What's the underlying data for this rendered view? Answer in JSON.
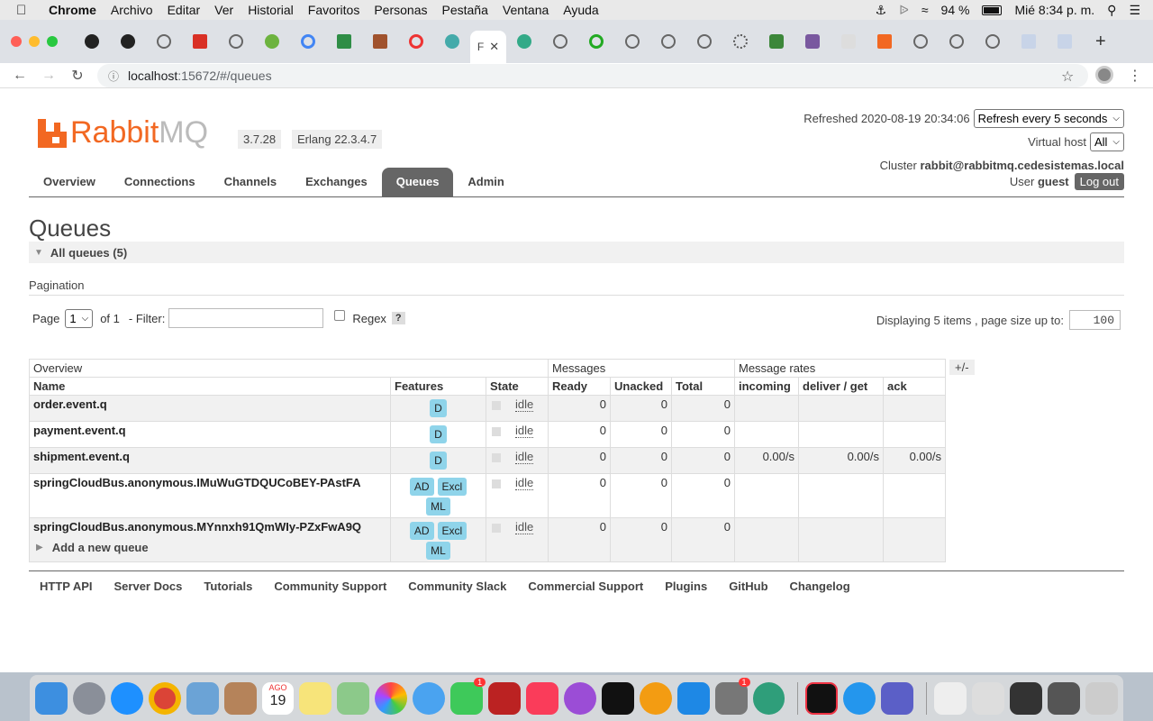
{
  "menubar": {
    "app": "Chrome",
    "items": [
      "Archivo",
      "Editar",
      "Ver",
      "Historial",
      "Favoritos",
      "Personas",
      "Pestaña",
      "Ventana",
      "Ayuda"
    ],
    "battery": "94 %",
    "clock": "Mié 8:34 p. m."
  },
  "browser": {
    "active_tab_label": "F",
    "url_host": "localhost",
    "url_rest": ":15672/#/queues"
  },
  "header": {
    "logo_rabbit": "Rabbit",
    "logo_mq": "MQ",
    "version": "3.7.28",
    "erlang": "Erlang 22.3.4.7",
    "refreshed_label": "Refreshed 2020-08-19 20:34:06",
    "refresh_select": "Refresh every 5 seconds",
    "vhost_label": "Virtual host",
    "vhost_value": "All",
    "cluster_label": "Cluster",
    "cluster_value": "rabbit@rabbitmq.cedesistemas.local",
    "user_label": "User",
    "user_value": "guest",
    "logout": "Log out"
  },
  "nav": [
    "Overview",
    "Connections",
    "Channels",
    "Exchanges",
    "Queues",
    "Admin"
  ],
  "page": {
    "title": "Queues",
    "section": "All queues (5)",
    "pagination_title": "Pagination",
    "page_label": "Page",
    "page_value": "1",
    "of_label": "of 1",
    "filter_label": "- Filter:",
    "regex_label": "Regex",
    "regex_help": "?",
    "displaying": "Displaying 5 items , page size up to:",
    "page_size": "100",
    "plusminus": "+/-",
    "add_queue": "Add a new queue"
  },
  "table": {
    "groups": [
      "Overview",
      "Messages",
      "Message rates"
    ],
    "columns": [
      "Name",
      "Features",
      "State",
      "Ready",
      "Unacked",
      "Total",
      "incoming",
      "deliver / get",
      "ack"
    ],
    "rows": [
      {
        "name": "order.event.q",
        "features": [
          "D"
        ],
        "state": "idle",
        "ready": "0",
        "unacked": "0",
        "total": "0",
        "incoming": "",
        "deliver": "",
        "ack": ""
      },
      {
        "name": "payment.event.q",
        "features": [
          "D"
        ],
        "state": "idle",
        "ready": "0",
        "unacked": "0",
        "total": "0",
        "incoming": "",
        "deliver": "",
        "ack": ""
      },
      {
        "name": "shipment.event.q",
        "features": [
          "D"
        ],
        "state": "idle",
        "ready": "0",
        "unacked": "0",
        "total": "0",
        "incoming": "0.00/s",
        "deliver": "0.00/s",
        "ack": "0.00/s"
      },
      {
        "name": "springCloudBus.anonymous.IMuWuGTDQUCoBEY-PAstFA",
        "features": [
          "AD",
          "Excl",
          "ML"
        ],
        "state": "idle",
        "ready": "0",
        "unacked": "0",
        "total": "0",
        "incoming": "",
        "deliver": "",
        "ack": ""
      },
      {
        "name": "springCloudBus.anonymous.MYnnxh91QmWIy-PZxFwA9Q",
        "features": [
          "AD",
          "Excl",
          "ML"
        ],
        "state": "idle",
        "ready": "0",
        "unacked": "0",
        "total": "0",
        "incoming": "",
        "deliver": "",
        "ack": ""
      }
    ]
  },
  "footer": [
    "HTTP API",
    "Server Docs",
    "Tutorials",
    "Community Support",
    "Community Slack",
    "Commercial Support",
    "Plugins",
    "GitHub",
    "Changelog"
  ],
  "dock": {
    "calendar_month": "AGO",
    "calendar_day": "19",
    "badges": [
      "1",
      "1"
    ]
  },
  "colors": {
    "brand": "#f26822",
    "nav_active": "#666666",
    "feature_badge": "#8fd4ea"
  }
}
